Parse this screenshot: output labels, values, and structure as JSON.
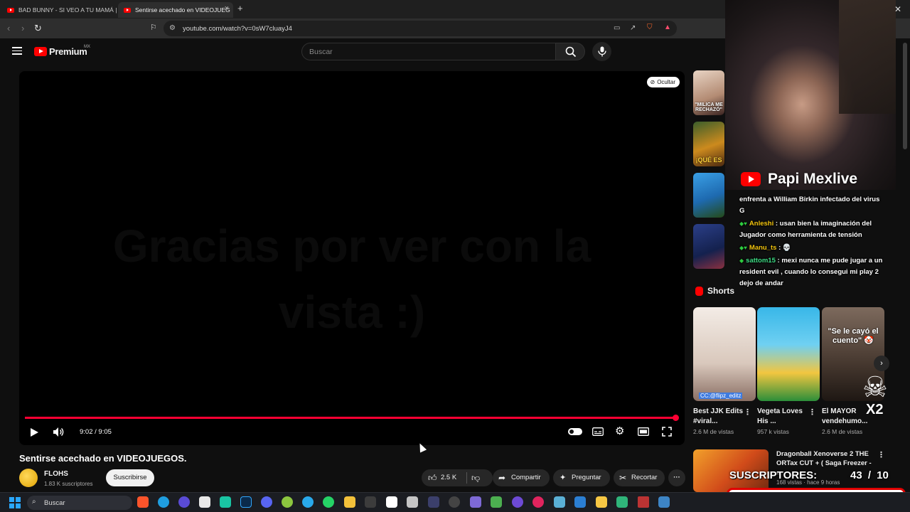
{
  "browser": {
    "tabs": [
      {
        "label": "BAD BUNNY - SI VEO A TU MAMÁ | Y",
        "active": false
      },
      {
        "label": "Sentirse acechado en VIDEOJUEG",
        "active": true
      }
    ],
    "new_tab": "+",
    "url": "youtube.com/watch?v=0sW7cluayJ4"
  },
  "header": {
    "logo_text": "Premium",
    "country": "MX",
    "search_placeholder": "Buscar"
  },
  "player": {
    "hide_label": "Ocultar",
    "endscreen_text": "Gracias por ver con la vista :)",
    "time": "9:02 / 9:05",
    "progress": 0.995
  },
  "video": {
    "title": "Sentirse acechado en VIDEOJUEGOS.",
    "channel": "FLOHS",
    "subscribers": "1.83 K suscriptores",
    "subscribe_label": "Suscribirse",
    "likes": "2.5 K",
    "share_label": "Compartir",
    "ask_label": "Preguntar",
    "clip_label": "Recortar"
  },
  "sidebar": {
    "thumb_captions": [
      "\"MILICA ME RECHAZÓ\"",
      "¡QUÉ ES",
      "",
      ""
    ],
    "shorts_label": "Shorts",
    "shorts": [
      {
        "title": "Best JJK Edits #viral...",
        "views": "2.6 M de vistas",
        "overlay": "CC:@flipz_editz"
      },
      {
        "title": "Vegeta Loves His ...",
        "views": "957 k vistas",
        "overlay": ""
      },
      {
        "title": "El MAYOR vendehumo...",
        "views": "2.6 M de vistas",
        "overlay": "\"Se le cayó el cuento\" 🤡"
      }
    ],
    "rec5": {
      "title": "Dragonball Xenoverse 2 THE ORTax CUT + ( Saga Freezer - ...",
      "meta": "168 vistas · hace 9 horas"
    }
  },
  "overlay": {
    "channel_brand": "Papi Mexlive",
    "chat": [
      {
        "user": "",
        "text": "enfrenta a William Birkin infectado del virus G",
        "user_color": ""
      },
      {
        "user": "Anleshi",
        "text": ": usan bien la imaginación del Jugador como herramienta de tensión",
        "user_color": "yellow"
      },
      {
        "user": "Manu_ts",
        "text": ": 💀",
        "user_color": "yellow"
      },
      {
        "user": "sattom15",
        "text": ": mexi nunca me pude jugar a un resident evil , cuando lo consegui mi play 2 dejo de andar",
        "user_color": "green"
      }
    ],
    "multiplier": "X2",
    "subs_goal_label": "SUSCRIPTORES:",
    "subs_goal_value": "43 / 10"
  },
  "taskbar": {
    "search_label": "Buscar"
  }
}
